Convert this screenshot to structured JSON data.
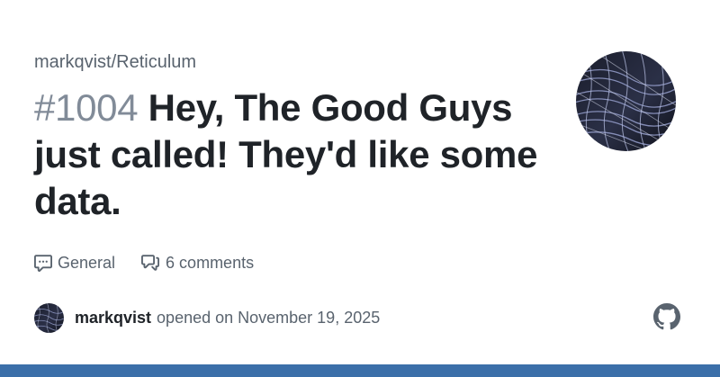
{
  "repo": {
    "name": "markqvist/Reticulum"
  },
  "discussion": {
    "number": "#1004",
    "title": "Hey, The Good Guys just called! They'd like some data.",
    "category_icon": "comment-discussion-icon",
    "category": "General",
    "comments_icon": "comments-icon",
    "comments": "6 comments"
  },
  "author": {
    "name": "markqvist",
    "opened_text": "opened on November 19, 2025"
  },
  "branding": {
    "logo_icon": "github-icon"
  },
  "colors": {
    "muted_text": "#59636e",
    "title_text": "#1f2328",
    "number_text": "#818b98",
    "bottom_bar": "#3b6fa9"
  }
}
